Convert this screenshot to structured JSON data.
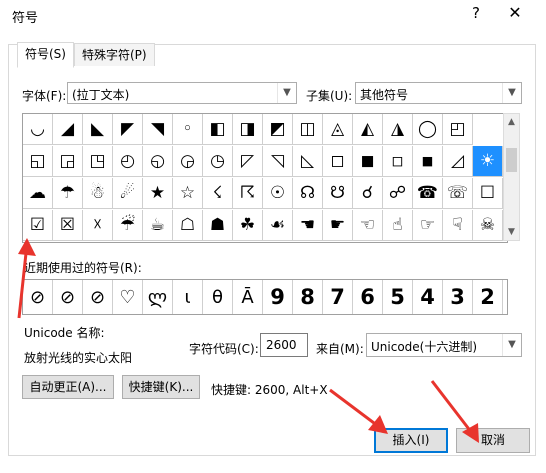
{
  "window": {
    "title": "符号",
    "help": "?",
    "close": "✕"
  },
  "tabs": [
    {
      "label": "符号(S)"
    },
    {
      "label": "特殊字符(P)"
    }
  ],
  "font": {
    "label": "字体(F):",
    "value": "(拉丁文本)"
  },
  "subset": {
    "label": "子集(U):",
    "value": "其他符号"
  },
  "symbols": [
    [
      "◡",
      "◢",
      "◣",
      "◤",
      "◥",
      "◦",
      "◧",
      "◨",
      "◩",
      "◫",
      "◬",
      "◭",
      "◮",
      "◯",
      "◰"
    ],
    [
      "◱",
      "◲",
      "◳",
      "◴",
      "◵",
      "◶",
      "◷",
      "◸",
      "◹",
      "◺",
      "◻",
      "◼",
      "◽",
      "◾",
      "◿",
      "☀"
    ],
    [
      "☁",
      "☂",
      "☃",
      "☄",
      "★",
      "☆",
      "☇",
      "☈",
      "☉",
      "☊",
      "☋",
      "☌",
      "☍",
      "☎",
      "☏",
      "☐"
    ],
    [
      "☑",
      "☒",
      "☓",
      "☔",
      "☕",
      "☖",
      "☗",
      "☘",
      "☙",
      "☚",
      "☛",
      "☜",
      "☝",
      "☞",
      "☟",
      "☠"
    ]
  ],
  "recent_label": "近期使用过的符号(R):",
  "recent": [
    "⊘",
    "⊘",
    "⊘",
    "♡",
    "ლ",
    "ι",
    "θ",
    "Ā",
    "9",
    "8",
    "7",
    "6",
    "5",
    "4",
    "3",
    "2"
  ],
  "unicode_name_label": "Unicode 名称:",
  "unicode_name_value": "放射光线的实心太阳",
  "charcode_label": "字符代码(C):",
  "charcode_value": "2600",
  "from_label": "来自(M):",
  "from_value": "Unicode(十六进制)",
  "autocorrect_button": "自动更正(A)...",
  "shortcut_button": "快捷键(K)...",
  "shortcut_text": "快捷键: 2600, Alt+X",
  "insert_button": "插入(I)",
  "cancel_button": "取消",
  "colors": {
    "selected": "#1e90ff",
    "annotation": "#e8342d"
  }
}
